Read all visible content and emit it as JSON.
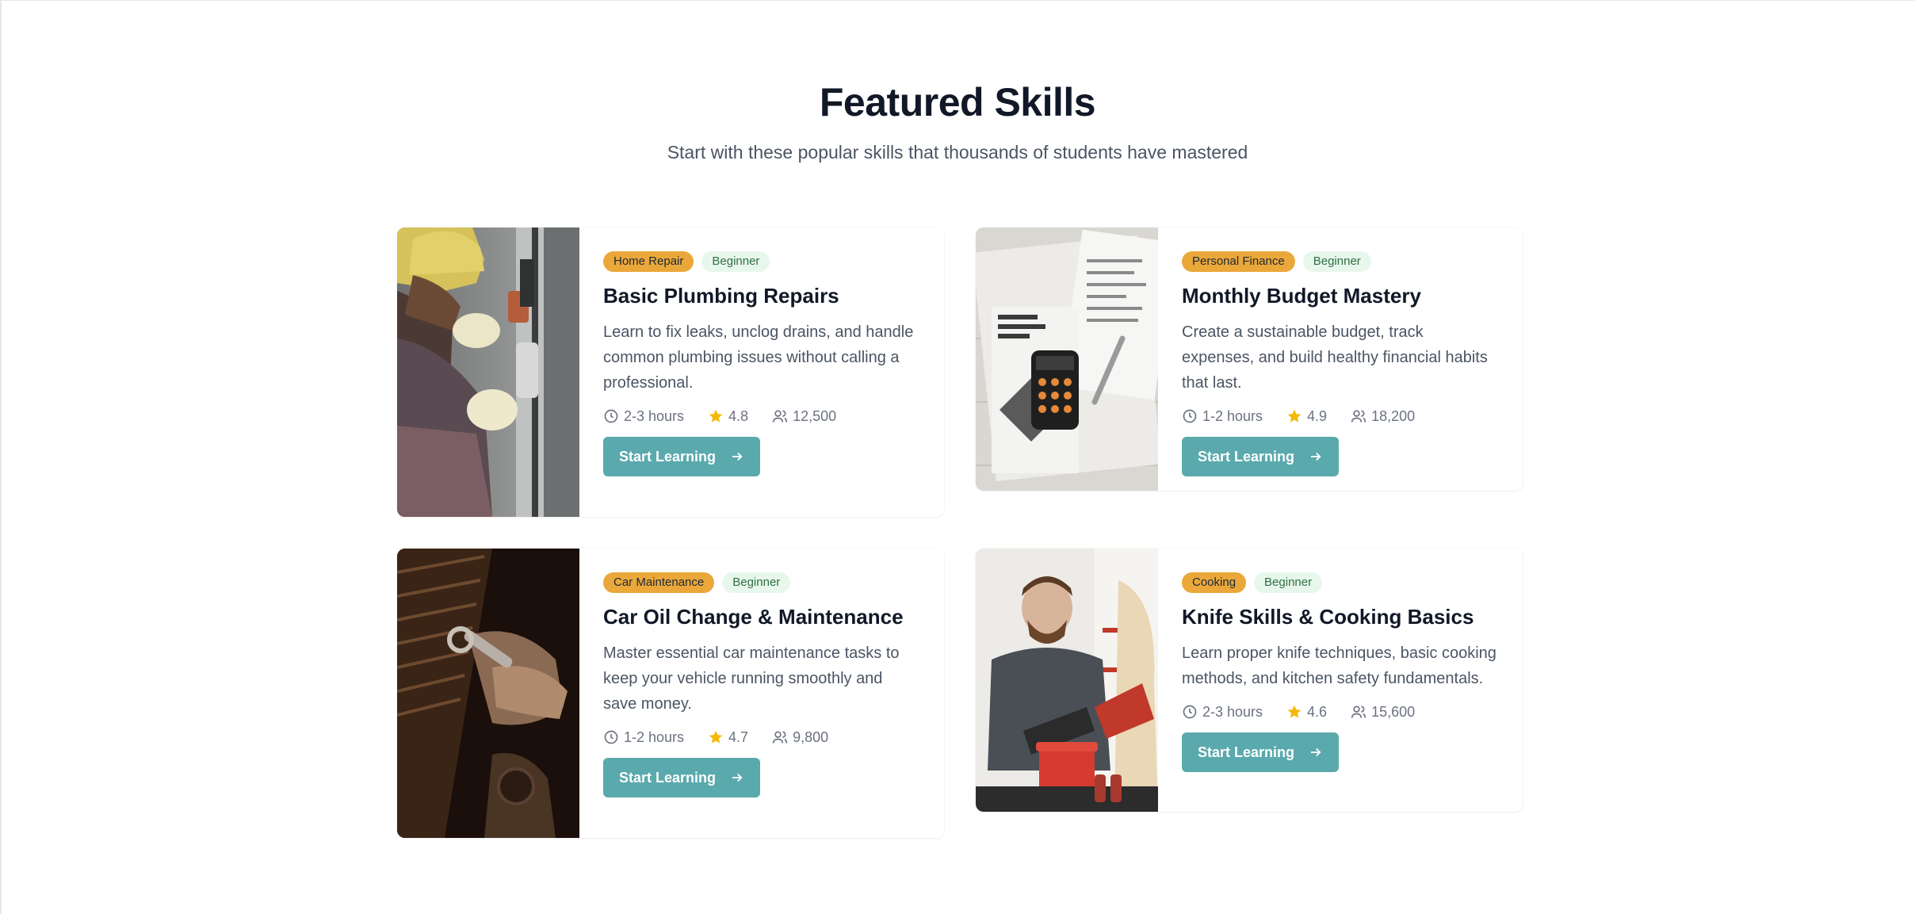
{
  "section": {
    "title": "Featured Skills",
    "subtitle": "Start with these popular skills that thousands of students have mastered"
  },
  "colors": {
    "accent": "#5aa9ad",
    "category_badge": "#eaa83a",
    "level_badge_bg": "#e8f7ec",
    "star": "#f5b90b"
  },
  "cards": [
    {
      "category": "Home Repair",
      "level": "Beginner",
      "title": "Basic Plumbing Repairs",
      "description": "Learn to fix leaks, unclog drains, and handle common plumbing issues without calling a professional.",
      "duration": "2-3 hours",
      "rating": "4.8",
      "students": "12,500",
      "button": "Start Learning"
    },
    {
      "category": "Personal Finance",
      "level": "Beginner",
      "title": "Monthly Budget Mastery",
      "description": "Create a sustainable budget, track expenses, and build healthy financial habits that last.",
      "duration": "1-2 hours",
      "rating": "4.9",
      "students": "18,200",
      "button": "Start Learning"
    },
    {
      "category": "Car Maintenance",
      "level": "Beginner",
      "title": "Car Oil Change & Maintenance",
      "description": "Master essential car maintenance tasks to keep your vehicle running smoothly and save money.",
      "duration": "1-2 hours",
      "rating": "4.7",
      "students": "9,800",
      "button": "Start Learning"
    },
    {
      "category": "Cooking",
      "level": "Beginner",
      "title": "Knife Skills & Cooking Basics",
      "description": "Learn proper knife techniques, basic cooking methods, and kitchen safety fundamentals.",
      "duration": "2-3 hours",
      "rating": "4.6",
      "students": "15,600",
      "button": "Start Learning"
    }
  ]
}
